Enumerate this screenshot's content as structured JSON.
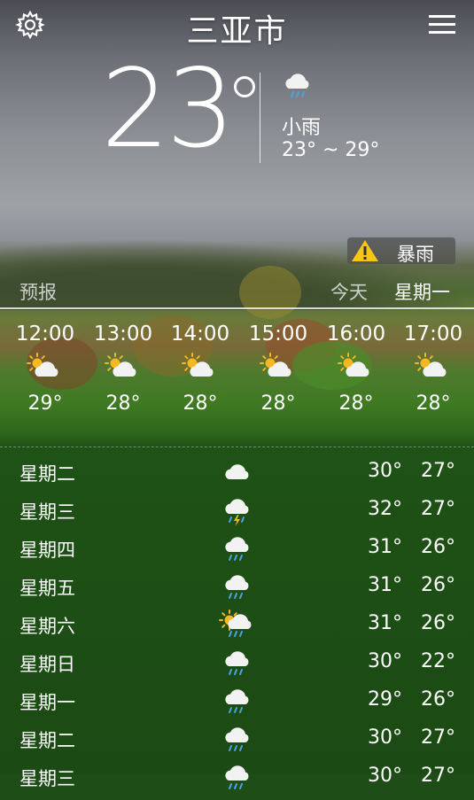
{
  "header": {
    "city": "三亚市",
    "settings_icon": "gear-icon",
    "menu_icon": "hamburger-menu-icon"
  },
  "current": {
    "temperature": "23",
    "condition": "小雨",
    "range": "23° ~ 29°",
    "icon": "light-rain-icon"
  },
  "alert": {
    "icon": "warning-icon",
    "label": "暴雨"
  },
  "tabs": {
    "forecast": "预报",
    "today": "今天",
    "weekday": "星期一"
  },
  "hourly": [
    {
      "time": "12:00",
      "temp": "29°",
      "icon": "partly-cloudy-icon"
    },
    {
      "time": "13:00",
      "temp": "28°",
      "icon": "partly-cloudy-icon"
    },
    {
      "time": "14:00",
      "temp": "28°",
      "icon": "partly-cloudy-icon"
    },
    {
      "time": "15:00",
      "temp": "28°",
      "icon": "partly-cloudy-icon"
    },
    {
      "time": "16:00",
      "temp": "28°",
      "icon": "partly-cloudy-icon"
    },
    {
      "time": "17:00",
      "temp": "28°",
      "icon": "partly-cloudy-icon"
    }
  ],
  "daily": [
    {
      "day": "星期二",
      "high": "30°",
      "low": "27°",
      "icon": "cloudy-icon"
    },
    {
      "day": "星期三",
      "high": "32°",
      "low": "27°",
      "icon": "thunderstorm-icon"
    },
    {
      "day": "星期四",
      "high": "31°",
      "low": "26°",
      "icon": "rain-icon"
    },
    {
      "day": "星期五",
      "high": "31°",
      "low": "26°",
      "icon": "rain-icon"
    },
    {
      "day": "星期六",
      "high": "31°",
      "low": "26°",
      "icon": "sun-rain-icon"
    },
    {
      "day": "星期日",
      "high": "30°",
      "low": "22°",
      "icon": "rain-icon"
    },
    {
      "day": "星期一",
      "high": "29°",
      "low": "26°",
      "icon": "rain-icon"
    },
    {
      "day": "星期二",
      "high": "30°",
      "low": "27°",
      "icon": "rain-icon"
    },
    {
      "day": "星期三",
      "high": "30°",
      "low": "27°",
      "icon": "rain-icon"
    }
  ],
  "colors": {
    "alert_icon": "#f5c518",
    "sun": "#f5b823",
    "cloud": "#f2f2f2",
    "rain": "#4aa3e6"
  }
}
